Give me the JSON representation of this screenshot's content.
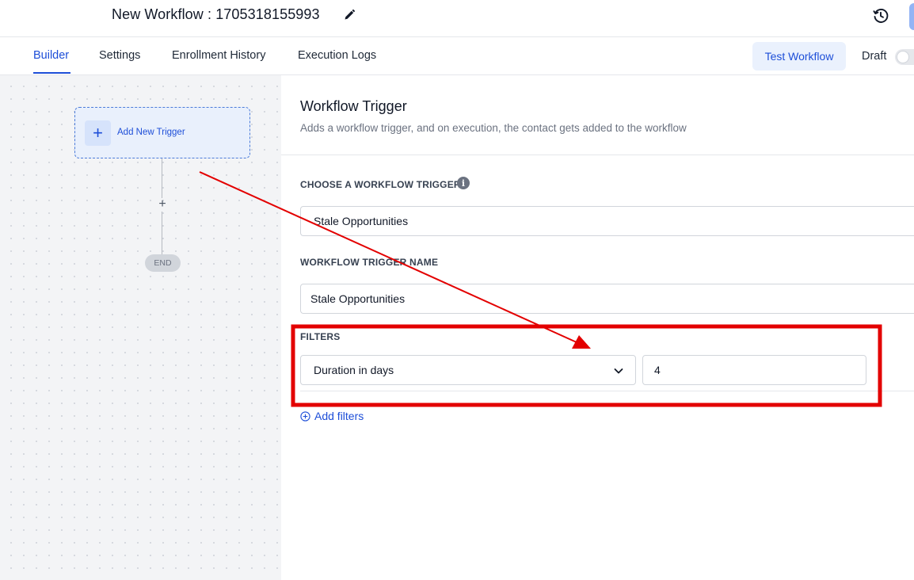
{
  "header": {
    "workflow_title": "New Workflow : 1705318155993",
    "edit_icon": "pencil-icon",
    "history_icon": "history-icon"
  },
  "tabs": {
    "items": [
      {
        "label": "Builder",
        "active": true
      },
      {
        "label": "Settings",
        "active": false
      },
      {
        "label": "Enrollment History",
        "active": false
      },
      {
        "label": "Execution Logs",
        "active": false
      }
    ],
    "test_button": "Test Workflow",
    "draft_label": "Draft",
    "draft_enabled": false
  },
  "canvas": {
    "trigger_label": "Add New Trigger",
    "add_step_symbol": "+",
    "end_label": "END"
  },
  "panel": {
    "title": "Workflow Trigger",
    "subtitle": "Adds a workflow trigger, and on execution, the contact gets added to the workflow",
    "choose_trigger_label": "CHOOSE A WORKFLOW TRIGGER",
    "choose_trigger_value": "Stale Opportunities",
    "trigger_name_label": "WORKFLOW TRIGGER NAME",
    "trigger_name_value": "Stale Opportunities",
    "filters_label": "FILTERS",
    "filter_field": "Duration in days",
    "filter_value": "4",
    "add_filters": "Add filters"
  },
  "colors": {
    "accent": "#1d4ed8",
    "annotation": "#e30000"
  }
}
